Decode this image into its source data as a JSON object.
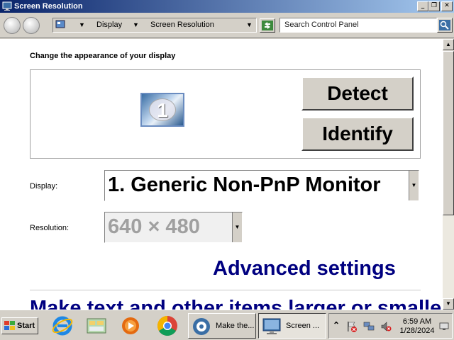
{
  "window": {
    "title": "Screen Resolution",
    "buttons": {
      "minimize": "_",
      "maximize": "❐",
      "close": "✕"
    }
  },
  "toolbar": {
    "breadcrumb": [
      "Display",
      "Screen Resolution"
    ],
    "search_placeholder": "Search Control Panel"
  },
  "content": {
    "heading": "Change the appearance of your display",
    "monitor_number": "1",
    "detect_label": "Detect",
    "identify_label": "Identify",
    "display_label": "Display:",
    "display_value": "1. Generic Non-PnP Monitor",
    "resolution_label": "Resolution:",
    "resolution_value": "640 × 480",
    "advanced_link": "Advanced settings",
    "make_text_link": "Make text and other items larger or smaller"
  },
  "taskbar": {
    "start_label": "Start",
    "quick_launch": [
      "internet-explorer-icon",
      "explorer-icon",
      "media-player-icon",
      "chrome-icon"
    ],
    "tasks": [
      {
        "label": "Make the...",
        "icon": "control-panel-icon",
        "active": false
      },
      {
        "label": "Screen ...",
        "icon": "display-icon",
        "active": true
      }
    ],
    "tray_expand": "⌃",
    "clock_time": "6:59 AM",
    "clock_date": "1/28/2024"
  },
  "colors": {
    "link": "#000080",
    "titlebar_start": "#0a246a",
    "titlebar_end": "#a6caf0",
    "face": "#d4d0c8"
  }
}
